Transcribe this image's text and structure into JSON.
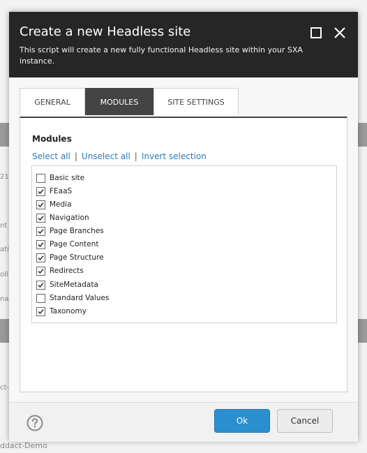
{
  "background": {
    "fragments": [
      "21-",
      "nt",
      "ati",
      "oll",
      "na",
      "ct-"
    ],
    "footer_text": "ddact-Demo"
  },
  "dialog": {
    "title": "Create a new Headless site",
    "subtitle": "This script will create a new fully functional Headless site within your SXA instance.",
    "icons": {
      "maximize": "maximize-icon",
      "close": "close-icon",
      "help": "help-icon"
    },
    "tabs": [
      {
        "label": "GENERAL",
        "active": false
      },
      {
        "label": "MODULES",
        "active": true
      },
      {
        "label": "SITE SETTINGS",
        "active": false
      }
    ],
    "modules_panel": {
      "heading": "Modules",
      "actions": {
        "select_all": "Select all",
        "separator": "|",
        "unselect_all": "Unselect all",
        "invert": "Invert selection"
      },
      "items": [
        {
          "label": "Basic site",
          "checked": false
        },
        {
          "label": "FEaaS",
          "checked": true
        },
        {
          "label": "Media",
          "checked": true
        },
        {
          "label": "Navigation",
          "checked": true
        },
        {
          "label": "Page Branches",
          "checked": true
        },
        {
          "label": "Page Content",
          "checked": true
        },
        {
          "label": "Page Structure",
          "checked": true
        },
        {
          "label": "Redirects",
          "checked": true
        },
        {
          "label": "SiteMetadata",
          "checked": true
        },
        {
          "label": "Standard Values",
          "checked": false
        },
        {
          "label": "Taxonomy",
          "checked": true
        }
      ]
    },
    "buttons": {
      "ok": "Ok",
      "cancel": "Cancel"
    },
    "colors": {
      "header_bg": "#262626",
      "accent": "#2b8fcf",
      "link": "#2b7bb9",
      "active_tab": "#444444"
    }
  }
}
